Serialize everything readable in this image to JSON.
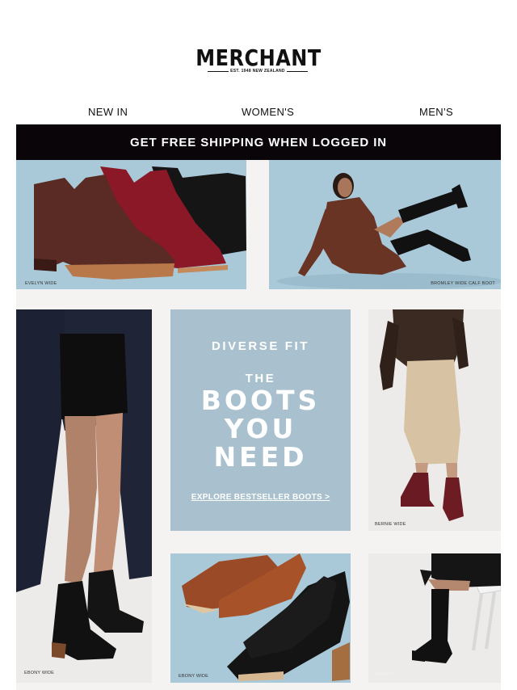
{
  "logo": {
    "name": "MERCHANT",
    "tagline": "EST. 1948 NEW ZEALAND"
  },
  "nav": {
    "new_in": "NEW IN",
    "womens": "WOMEN'S",
    "mens": "MEN'S"
  },
  "banner": {
    "text": "GET FREE SHIPPING WHEN LOGGED IN"
  },
  "promo": {
    "eyebrow": "DIVERSE FIT",
    "the": "THE",
    "line1": "BOOTS",
    "line2": "YOU",
    "line3": "NEED",
    "cta": "EXPLORE BESTSELLER BOOTS >"
  },
  "products": {
    "evelyn": "EVELYN WIDE",
    "bromley": "BROMLEY WIDE CALF BOOT",
    "ebony_model": "EBONY WIDE",
    "bernie": "BERNIE WIDE",
    "ebony_pair": "EBONY WIDE",
    "ainsley": "AINSLEY"
  },
  "colors": {
    "banner_bg": "#0a0508",
    "promo_bg": "#a9c1cf",
    "sky_blue": "#a8c8d8",
    "grid_bg": "#f5f3f1"
  }
}
